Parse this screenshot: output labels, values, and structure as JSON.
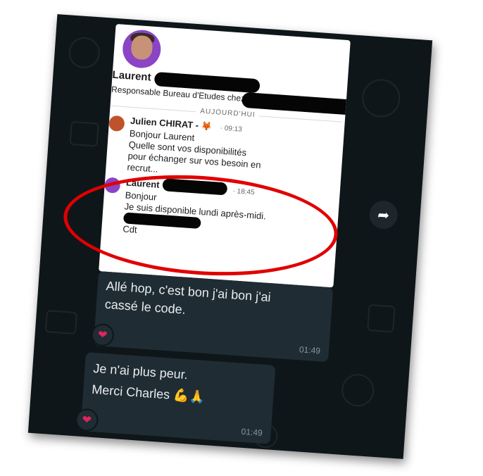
{
  "card": {
    "profile_name": "Laurent",
    "profile_title": "Responsable Bureau d'Etudes chez",
    "day_label": "AUJOURD'HUI",
    "messages": [
      {
        "name": "Julien CHIRAT -",
        "emoji": "🦊",
        "time": "· 09:13",
        "lines": [
          "Bonjour Laurent",
          "Quelle sont vos disponibilités",
          "pour échanger sur vos besoin en",
          "recrut..."
        ]
      },
      {
        "name": "Laurent",
        "time": "· 18:45",
        "lines": [
          "Bonjour",
          "Je suis disponible lundi après-midi.",
          "",
          "Cdt"
        ]
      }
    ]
  },
  "bubbles": [
    {
      "text_1": "Allé hop, c'est bon j'ai bon j'ai",
      "text_2": "cassé le code.",
      "time": "01:49",
      "reaction": "❤"
    },
    {
      "text_1": "Je n'ai plus peur.",
      "text_2": "Merci Charles 💪🙏",
      "time": "01:49",
      "reaction": "❤"
    }
  ],
  "icons": {
    "forward": "forward-arrow-icon",
    "reaction": "red-heart-icon"
  },
  "colors": {
    "annotation": "#e00000",
    "bubble": "#1f2c34",
    "background": "#0f1619"
  }
}
